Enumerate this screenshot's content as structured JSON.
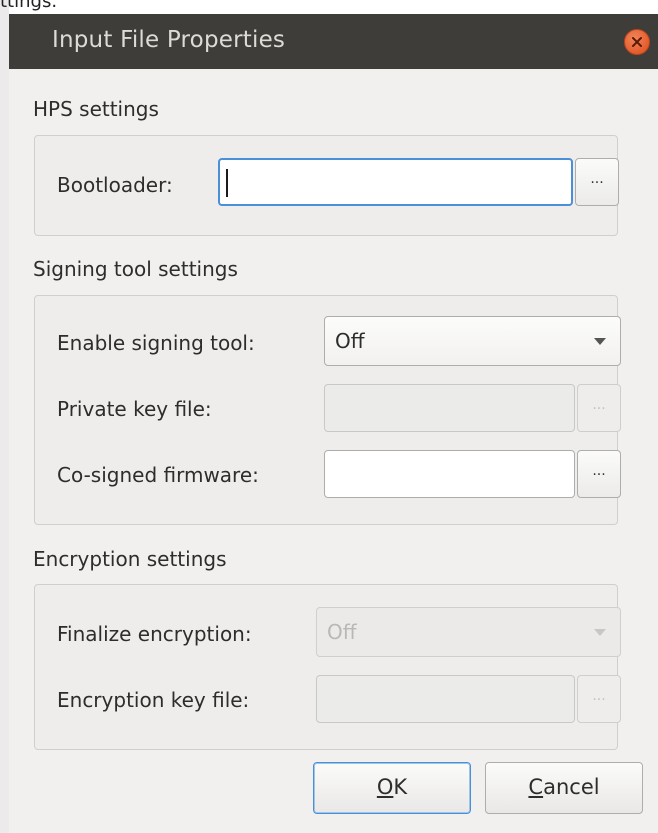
{
  "window": {
    "title": "Input File Properties"
  },
  "hps": {
    "title": "HPS settings",
    "bootloader_label": "Bootloader:",
    "bootloader_value": "",
    "browse_label": "..."
  },
  "signing": {
    "title": "Signing tool settings",
    "enable_label": "Enable signing tool:",
    "enable_value": "Off",
    "private_key_label": "Private key file:",
    "private_key_value": "",
    "cosigned_label": "Co-signed firmware:",
    "cosigned_value": "",
    "browse_label": "..."
  },
  "encryption": {
    "title": "Encryption settings",
    "finalize_label": "Finalize encryption:",
    "finalize_value": "Off",
    "key_label": "Encryption key file:",
    "key_value": "",
    "browse_label": "..."
  },
  "buttons": {
    "ok_mnemonic": "O",
    "ok_rest": "K",
    "cancel_mnemonic": "C",
    "cancel_rest": "ancel"
  },
  "background_text": "ttings."
}
